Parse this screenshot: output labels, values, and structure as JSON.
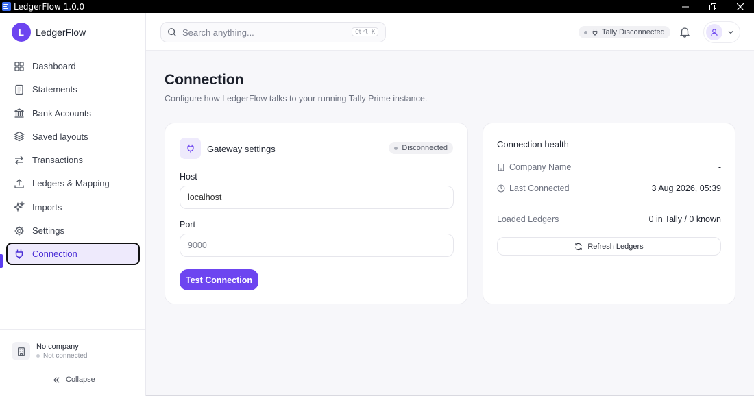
{
  "window": {
    "title": "LedgerFlow 1.0.0"
  },
  "brand": {
    "initial": "L",
    "name": "LedgerFlow"
  },
  "sidebar": {
    "items": [
      {
        "label": "Dashboard",
        "icon": "grid-icon"
      },
      {
        "label": "Statements",
        "icon": "document-icon"
      },
      {
        "label": "Bank Accounts",
        "icon": "bank-icon"
      },
      {
        "label": "Saved layouts",
        "icon": "layers-icon"
      },
      {
        "label": "Transactions",
        "icon": "swap-arrows-icon"
      },
      {
        "label": "Ledgers & Mapping",
        "icon": "upload-icon"
      },
      {
        "label": "Imports",
        "icon": "sparkles-icon"
      },
      {
        "label": "Settings",
        "icon": "gear-icon"
      },
      {
        "label": "Connection",
        "icon": "plug-icon",
        "active": true
      }
    ],
    "company": {
      "title": "No company",
      "status": "Not connected"
    },
    "collapse_label": "Collapse"
  },
  "header": {
    "search_placeholder": "Search anything...",
    "shortcut": "Ctrl K",
    "tally_status": "Tally Disconnected"
  },
  "main": {
    "title": "Connection",
    "subtitle": "Configure how LedgerFlow talks to your running Tally Prime instance.",
    "gateway": {
      "title": "Gateway settings",
      "badge": "Disconnected",
      "host_label": "Host",
      "host_value": "localhost",
      "port_label": "Port",
      "port_placeholder": "9000",
      "test_button": "Test Connection"
    },
    "health": {
      "title": "Connection health",
      "company_label": "Company Name",
      "company_value": "-",
      "last_label": "Last Connected",
      "last_value": "3 Aug 2026, 05:39",
      "ledgers_label": "Loaded Ledgers",
      "ledgers_value": "0 in Tally / 0 known",
      "refresh_button": "Refresh Ledgers"
    }
  },
  "colors": {
    "accent": "#6d45f0",
    "accent_soft": "#eeeafc",
    "muted": "#6d7280"
  }
}
